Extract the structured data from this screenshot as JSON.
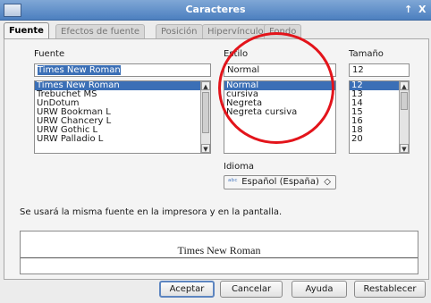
{
  "window": {
    "title": "Caracteres",
    "buttons": [
      "↑",
      "X"
    ]
  },
  "tabs": [
    {
      "label": "Fuente",
      "active": true
    },
    {
      "label": "Efectos de fuente",
      "active": false
    },
    {
      "label": "Posición",
      "active": false
    },
    {
      "label": "Hipervínculo",
      "active": false
    },
    {
      "label": "Fondo",
      "active": false
    }
  ],
  "font": {
    "label": "Fuente",
    "value": "Times New Roman",
    "options": [
      "Times New Roman",
      "Trebuchet MS",
      "UnDotum",
      "URW Bookman L",
      "URW Chancery L",
      "URW Gothic L",
      "URW Palladio L"
    ],
    "selected_index": 0
  },
  "style": {
    "label": "Estilo",
    "value": "Normal",
    "options": [
      "Normal",
      "cursiva",
      "Negreta",
      "Negreta cursiva"
    ],
    "selected_index": 0
  },
  "size": {
    "label": "Tamaño",
    "value": "12",
    "options": [
      "12",
      "13",
      "14",
      "15",
      "16",
      "18",
      "20"
    ],
    "selected_index": 0
  },
  "language": {
    "label": "Idioma",
    "value": "Español (España)",
    "icon": "spellcheck-icon"
  },
  "info_text": "Se usará la misma fuente en la impresora y en la pantalla.",
  "preview_text": "Times New Roman",
  "buttons": {
    "accept": "Aceptar",
    "cancel": "Cancelar",
    "help": "Ayuda",
    "reset": "Restablecer"
  },
  "colors": {
    "selection": "#3b6fb6",
    "annotation_circle": "#e3141b",
    "titlebar": "#5b8bc8"
  }
}
